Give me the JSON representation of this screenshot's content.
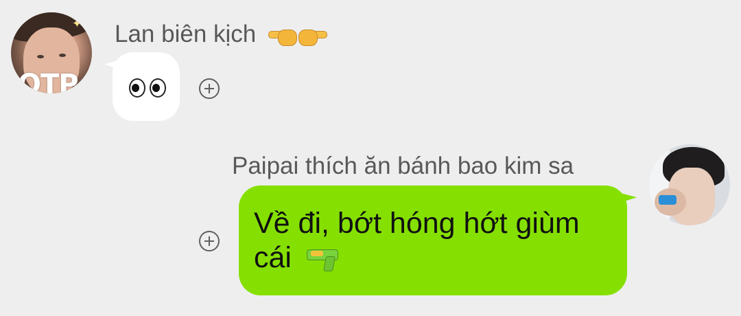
{
  "messages": [
    {
      "sender": "Lan biên kịch",
      "sender_emoji": "pointing-hands-icon",
      "avatar_text": "OTP",
      "bubble_content": "eyes-emoji",
      "bubble_color": "#ffffff",
      "reaction_icon": "add-circle-icon"
    },
    {
      "sender": "Paipai thích ăn bánh bao kim sa",
      "bubble_text_line1": "Về đi, bớt hóng hớt giùm",
      "bubble_text_line2": "cái",
      "bubble_emoji": "water-pistol-icon",
      "bubble_color": "#85e002",
      "reaction_icon": "add-circle-icon"
    }
  ],
  "colors": {
    "background": "#eeeeee",
    "sender_text": "#585858",
    "icon": "#5f5f5f"
  }
}
